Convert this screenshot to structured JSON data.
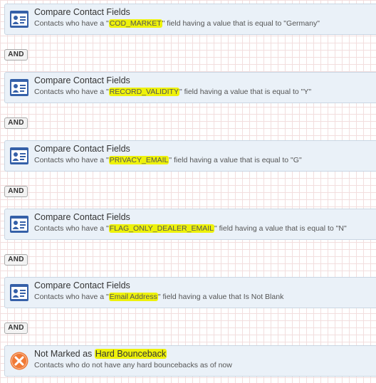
{
  "criteria": [
    {
      "title": "Compare Contact Fields",
      "desc_prefix": "Contacts who have a \"",
      "field": "COD_MARKET",
      "desc_suffix": "\" field having a value that is equal to \"Germany\"",
      "icon": "contact-card-icon"
    },
    {
      "title": "Compare Contact Fields",
      "desc_prefix": "Contacts who have a \"",
      "field": "RECORD_VALIDITY",
      "desc_suffix": "\" field having a value that is equal to \"Y\"",
      "icon": "contact-card-icon"
    },
    {
      "title": "Compare Contact Fields",
      "desc_prefix": "Contacts who have a \"",
      "field": "PRIVACY_EMAIL",
      "desc_suffix": "\" field having a value that is equal to \"G\"",
      "icon": "contact-card-icon"
    },
    {
      "title": "Compare Contact Fields",
      "desc_prefix": "Contacts who have a \"",
      "field": "FLAG_ONLY_DEALER_EMAIL",
      "desc_suffix": "\" field having a value that is equal to \"N\"",
      "icon": "contact-card-icon"
    },
    {
      "title": "Compare Contact Fields",
      "desc_prefix": "Contacts who have a \"",
      "field": "Email Address",
      "desc_suffix": "\" field having a value that Is Not Blank",
      "icon": "contact-card-icon"
    }
  ],
  "operators": [
    "AND",
    "AND",
    "AND",
    "AND",
    "AND"
  ],
  "bounce": {
    "title_prefix": "Not Marked as ",
    "title_highlight": "Hard Bounceback",
    "desc": "Contacts who do not have any hard bouncebacks as of now",
    "icon": "x-circle-icon"
  },
  "colors": {
    "highlight": "#eef20a",
    "card_background": "#eaf1f8",
    "icon_blue": "#3560a8",
    "bounce_orange": "#f07a36"
  }
}
